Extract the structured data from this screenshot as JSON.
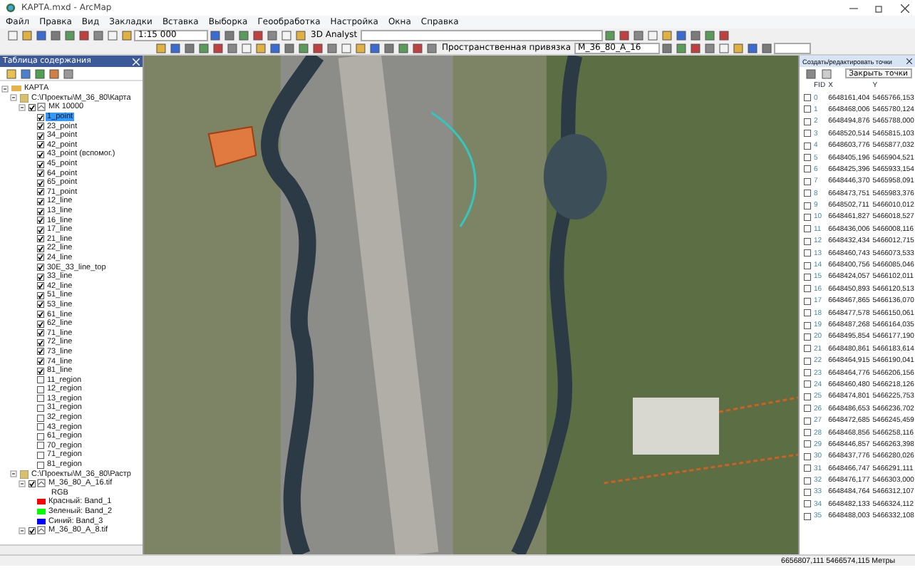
{
  "window": {
    "title": "КАРТА.mxd - ArcMap"
  },
  "menu": [
    "Файл",
    "Правка",
    "Вид",
    "Закладки",
    "Вставка",
    "Выборка",
    "Геообработка",
    "Настройка",
    "Окна",
    "Справка"
  ],
  "toolbar": {
    "scale": "1:15 000",
    "analyst_label": "3D Analyst",
    "georef_label": "Пространственная привязка",
    "georef_layer": "M_36_80_А_16"
  },
  "toc": {
    "title": "Таблица содержания",
    "tree": [
      {
        "label": "КАРТА",
        "kind": "frame",
        "expanded": true,
        "children": [
          {
            "label": "C:\\Проекты\\М_36_80\\Карта",
            "kind": "folder",
            "expanded": true,
            "children": [
              {
                "label": "МК 10000",
                "kind": "group",
                "expanded": true,
                "checked": true,
                "children": [
                  {
                    "label": "1_point",
                    "kind": "layer",
                    "checked": true,
                    "selected": true
                  },
                  {
                    "label": "23_point",
                    "kind": "layer",
                    "checked": true,
                    "selected": false
                  },
                  {
                    "label": "34_point",
                    "kind": "layer",
                    "checked": true,
                    "selected": false
                  },
                  {
                    "label": "42_point",
                    "kind": "layer",
                    "checked": true,
                    "selected": false
                  },
                  {
                    "label": "43_point (вспомог.)",
                    "kind": "layer",
                    "checked": true,
                    "selected": false
                  },
                  {
                    "label": "45_point",
                    "kind": "layer",
                    "checked": true,
                    "selected": false
                  },
                  {
                    "label": "64_point",
                    "kind": "layer",
                    "checked": true,
                    "selected": false
                  },
                  {
                    "label": "65_point",
                    "kind": "layer",
                    "checked": true,
                    "selected": false
                  },
                  {
                    "label": "71_point",
                    "kind": "layer",
                    "checked": true,
                    "selected": false
                  },
                  {
                    "label": "12_line",
                    "kind": "layer",
                    "checked": true,
                    "selected": false
                  },
                  {
                    "label": "13_line",
                    "kind": "layer",
                    "checked": true,
                    "selected": false
                  },
                  {
                    "label": "16_line",
                    "kind": "layer",
                    "checked": true,
                    "selected": false
                  },
                  {
                    "label": "17_line",
                    "kind": "layer",
                    "checked": true,
                    "selected": false
                  },
                  {
                    "label": "21_line",
                    "kind": "layer",
                    "checked": true,
                    "selected": false
                  },
                  {
                    "label": "22_line",
                    "kind": "layer",
                    "checked": true,
                    "selected": false
                  },
                  {
                    "label": "24_line",
                    "kind": "layer",
                    "checked": true,
                    "selected": false
                  },
                  {
                    "label": "30E_33_line_top",
                    "kind": "layer",
                    "checked": true,
                    "selected": false
                  },
                  {
                    "label": "33_line",
                    "kind": "layer",
                    "checked": true,
                    "selected": false
                  },
                  {
                    "label": "42_line",
                    "kind": "layer",
                    "checked": true,
                    "selected": false
                  },
                  {
                    "label": "51_line",
                    "kind": "layer",
                    "checked": true,
                    "selected": false
                  },
                  {
                    "label": "53_line",
                    "kind": "layer",
                    "checked": true,
                    "selected": false
                  },
                  {
                    "label": "61_line",
                    "kind": "layer",
                    "checked": true,
                    "selected": false
                  },
                  {
                    "label": "62_line",
                    "kind": "layer",
                    "checked": true,
                    "selected": false
                  },
                  {
                    "label": "71_line",
                    "kind": "layer",
                    "checked": true,
                    "selected": false
                  },
                  {
                    "label": "72_line",
                    "kind": "layer",
                    "checked": true,
                    "selected": false
                  },
                  {
                    "label": "73_line",
                    "kind": "layer",
                    "checked": true,
                    "selected": false
                  },
                  {
                    "label": "74_line",
                    "kind": "layer",
                    "checked": true,
                    "selected": false
                  },
                  {
                    "label": "81_line",
                    "kind": "layer",
                    "checked": true,
                    "selected": false
                  },
                  {
                    "label": "11_region",
                    "kind": "layer",
                    "checked": false,
                    "selected": false
                  },
                  {
                    "label": "12_region",
                    "kind": "layer",
                    "checked": false,
                    "selected": false
                  },
                  {
                    "label": "13_region",
                    "kind": "layer",
                    "checked": false,
                    "selected": false
                  },
                  {
                    "label": "31_region",
                    "kind": "layer",
                    "checked": false,
                    "selected": false
                  },
                  {
                    "label": "32_region",
                    "kind": "layer",
                    "checked": false,
                    "selected": false
                  },
                  {
                    "label": "43_region",
                    "kind": "layer",
                    "checked": false,
                    "selected": false
                  },
                  {
                    "label": "61_region",
                    "kind": "layer",
                    "checked": false,
                    "selected": false
                  },
                  {
                    "label": "70_region",
                    "kind": "layer",
                    "checked": false,
                    "selected": false
                  },
                  {
                    "label": "71_region",
                    "kind": "layer",
                    "checked": false,
                    "selected": false
                  },
                  {
                    "label": "81_region",
                    "kind": "layer",
                    "checked": false,
                    "selected": false
                  }
                ]
              }
            ]
          },
          {
            "label": "C:\\Проекты\\М_36_80\\Растр",
            "kind": "folder",
            "expanded": true,
            "children": [
              {
                "label": "M_36_80_А_16.tif",
                "kind": "group",
                "expanded": true,
                "checked": true,
                "children": [
                  {
                    "label": "RGB",
                    "kind": "caption"
                  },
                  {
                    "label": "Красный: Band_1",
                    "kind": "legend",
                    "color": "#ff0000"
                  },
                  {
                    "label": "Зеленый: Band_2",
                    "kind": "legend",
                    "color": "#00ff00"
                  },
                  {
                    "label": "Синий: Band_3",
                    "kind": "legend",
                    "color": "#0000ff"
                  }
                ]
              },
              {
                "label": "M_36_80_А_8.tif",
                "kind": "group",
                "expanded": true,
                "checked": true
              }
            ]
          }
        ]
      }
    ]
  },
  "table_panel": {
    "title": "Создать/редактировать точки",
    "button": "Закрыть точки",
    "columns": [
      "FID",
      "X",
      "Y"
    ],
    "rows": [
      {
        "checked": false,
        "cells": [
          "0",
          "6648161,404",
          "5465766,153"
        ]
      },
      {
        "checked": false,
        "cells": [
          "1",
          "6648468,006",
          "5465780,124"
        ]
      },
      {
        "checked": false,
        "cells": [
          "2",
          "6648494,876",
          "5465788,000"
        ]
      },
      {
        "checked": false,
        "cells": [
          "3",
          "6648520,514",
          "5465815,103"
        ]
      },
      {
        "checked": false,
        "cells": [
          "4",
          "6648603,776",
          "5465877,032"
        ]
      },
      {
        "checked": false,
        "cells": [
          "5",
          "6648405,196",
          "5465904,521"
        ]
      },
      {
        "checked": false,
        "cells": [
          "6",
          "6648425,396",
          "5465933,154"
        ]
      },
      {
        "checked": false,
        "cells": [
          "7",
          "6648446,370",
          "5465958,091"
        ]
      },
      {
        "checked": false,
        "cells": [
          "8",
          "6648473,751",
          "5465983,376"
        ]
      },
      {
        "checked": false,
        "cells": [
          "9",
          "6648502,711",
          "5466010,012"
        ]
      },
      {
        "checked": false,
        "cells": [
          "10",
          "6648461,827",
          "5466018,527"
        ]
      },
      {
        "checked": false,
        "cells": [
          "11",
          "6648436,006",
          "5466008,116"
        ]
      },
      {
        "checked": false,
        "cells": [
          "12",
          "6648432,434",
          "5466012,715"
        ]
      },
      {
        "checked": false,
        "cells": [
          "13",
          "6648460,743",
          "5466073,533"
        ]
      },
      {
        "checked": false,
        "cells": [
          "14",
          "6648400,756",
          "5466085,046"
        ]
      },
      {
        "checked": false,
        "cells": [
          "15",
          "6648424,057",
          "5466102,011"
        ]
      },
      {
        "checked": false,
        "cells": [
          "16",
          "6648450,893",
          "5466120,513"
        ]
      },
      {
        "checked": false,
        "cells": [
          "17",
          "6648467,865",
          "5466136,070"
        ]
      },
      {
        "checked": false,
        "cells": [
          "18",
          "6648477,578",
          "5466150,061"
        ]
      },
      {
        "checked": false,
        "cells": [
          "19",
          "6648487,268",
          "5466164,035"
        ]
      },
      {
        "checked": false,
        "cells": [
          "20",
          "6648495,854",
          "5466177,190"
        ]
      },
      {
        "checked": false,
        "cells": [
          "21",
          "6648480,861",
          "5466183,614"
        ]
      },
      {
        "checked": false,
        "cells": [
          "22",
          "6648464,915",
          "5466190,041"
        ]
      },
      {
        "checked": false,
        "cells": [
          "23",
          "6648464,776",
          "5466206,156"
        ]
      },
      {
        "checked": false,
        "cells": [
          "24",
          "6648460,480",
          "5466218,126"
        ]
      },
      {
        "checked": false,
        "cells": [
          "25",
          "6648474,801",
          "5466225,753"
        ]
      },
      {
        "checked": false,
        "cells": [
          "26",
          "6648486,653",
          "5466236,702"
        ]
      },
      {
        "checked": false,
        "cells": [
          "27",
          "6648472,685",
          "5466245,459"
        ]
      },
      {
        "checked": false,
        "cells": [
          "28",
          "6648468,856",
          "5466258,116"
        ]
      },
      {
        "checked": false,
        "cells": [
          "29",
          "6648446,857",
          "5466263,398"
        ]
      },
      {
        "checked": false,
        "cells": [
          "30",
          "6648437,776",
          "5466280,026"
        ]
      },
      {
        "checked": false,
        "cells": [
          "31",
          "6648466,747",
          "5466291,111"
        ]
      },
      {
        "checked": false,
        "cells": [
          "32",
          "6648476,177",
          "5466303,000"
        ]
      },
      {
        "checked": false,
        "cells": [
          "33",
          "6648484,764",
          "5466312,107"
        ]
      },
      {
        "checked": false,
        "cells": [
          "34",
          "6648482,133",
          "5466324,112"
        ]
      },
      {
        "checked": false,
        "cells": [
          "35",
          "6648488,003",
          "5466332,108"
        ]
      }
    ]
  },
  "status_bar": {
    "coordinates": "6656807,111  5466574,115 Метры"
  }
}
